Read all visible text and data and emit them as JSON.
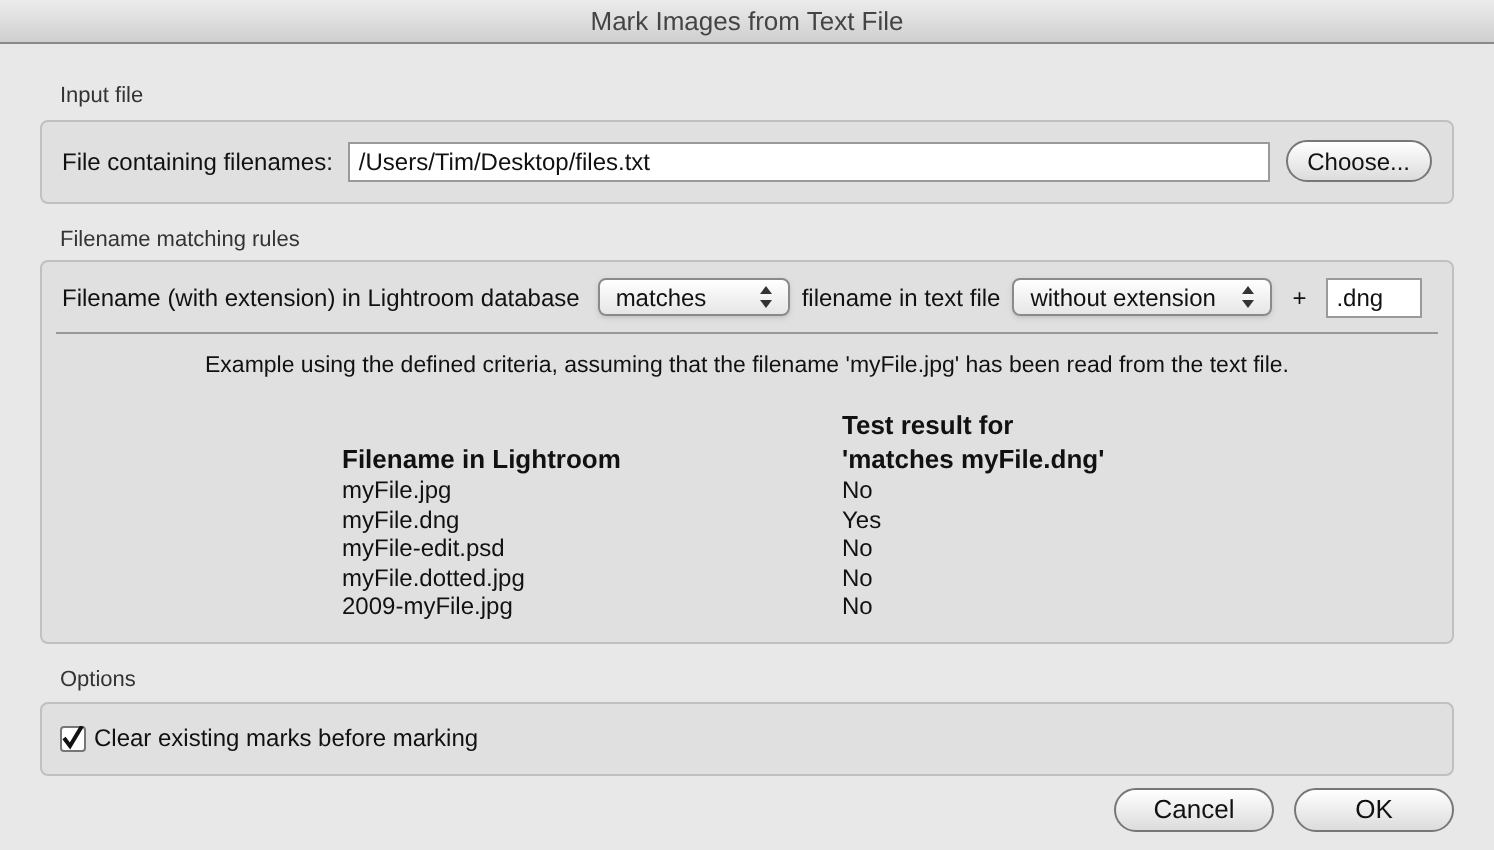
{
  "window": {
    "title": "Mark Images from Text File"
  },
  "input_file": {
    "heading": "Input file",
    "label": "File containing filenames:",
    "value": "/Users/Tim/Desktop/files.txt",
    "button": "Choose..."
  },
  "matching_rules": {
    "heading": "Filename matching rules",
    "label": "Filename (with extension) in Lightroom database",
    "match_select": "matches",
    "middle_label": "filename in text file",
    "extension_select": "without extension",
    "plus": "+",
    "extension_value": ".dng",
    "example": "Example using the defined criteria, assuming that the filename 'myFile.jpg' has been read from the text file.",
    "table": {
      "columns": [
        "Filename in Lightroom",
        "Test result for\n'matches myFile.dng'"
      ],
      "rows": [
        [
          "myFile.jpg",
          "No"
        ],
        [
          "myFile.dng",
          "Yes"
        ],
        [
          "myFile-edit.psd",
          "No"
        ],
        [
          "myFile.dotted.jpg",
          "No"
        ],
        [
          "2009-myFile.jpg",
          "No"
        ]
      ]
    }
  },
  "options": {
    "heading": "Options",
    "checkbox": {
      "label": "Clear existing marks before marking",
      "checked": true
    }
  },
  "buttons": [
    "Cancel",
    "OK"
  ]
}
